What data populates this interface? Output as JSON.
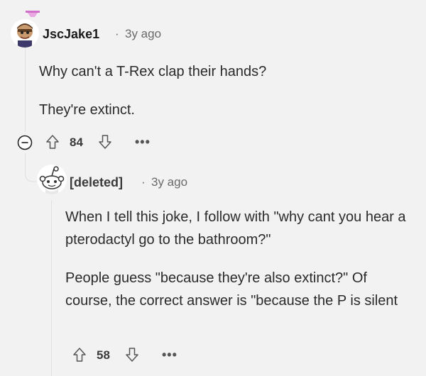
{
  "comments": [
    {
      "username": "JscJake1",
      "separator": "·",
      "age": "3y ago",
      "paragraphs": [
        "Why can't a T-Rex clap their hands?",
        "They're extinct."
      ],
      "votes": "84",
      "more": "•••"
    },
    {
      "username": "[deleted]",
      "separator": "·",
      "age": "3y ago",
      "paragraphs": [
        "When I tell this joke, I follow with \"why cant you hear a pterodactyl go to the bathroom?\"",
        "People guess \"because they're also extinct?\" Of course, the correct answer is \"because the P is silent"
      ],
      "votes": "58",
      "more": "•••"
    }
  ]
}
